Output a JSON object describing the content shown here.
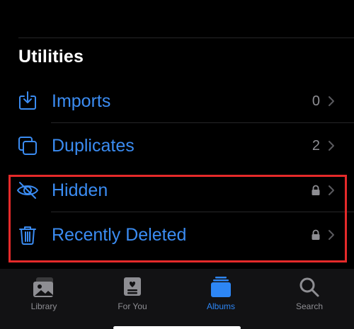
{
  "section": {
    "title": "Utilities"
  },
  "rows": [
    {
      "label": "Imports",
      "count": "0",
      "icon": "import-icon",
      "locked": false
    },
    {
      "label": "Duplicates",
      "count": "2",
      "icon": "duplicates-icon",
      "locked": false
    },
    {
      "label": "Hidden",
      "count": "",
      "icon": "hidden-eye-icon",
      "locked": true
    },
    {
      "label": "Recently Deleted",
      "count": "",
      "icon": "trash-icon",
      "locked": true
    }
  ],
  "tabs": [
    {
      "label": "Library",
      "icon": "library-icon",
      "active": false
    },
    {
      "label": "For You",
      "icon": "for-you-icon",
      "active": false
    },
    {
      "label": "Albums",
      "icon": "albums-icon",
      "active": true
    },
    {
      "label": "Search",
      "icon": "search-icon",
      "active": false
    }
  ],
  "colors": {
    "accent": "#3b8cf2",
    "background": "#000000",
    "highlight": "#e52a2a",
    "secondary_text": "#8e8e93"
  }
}
